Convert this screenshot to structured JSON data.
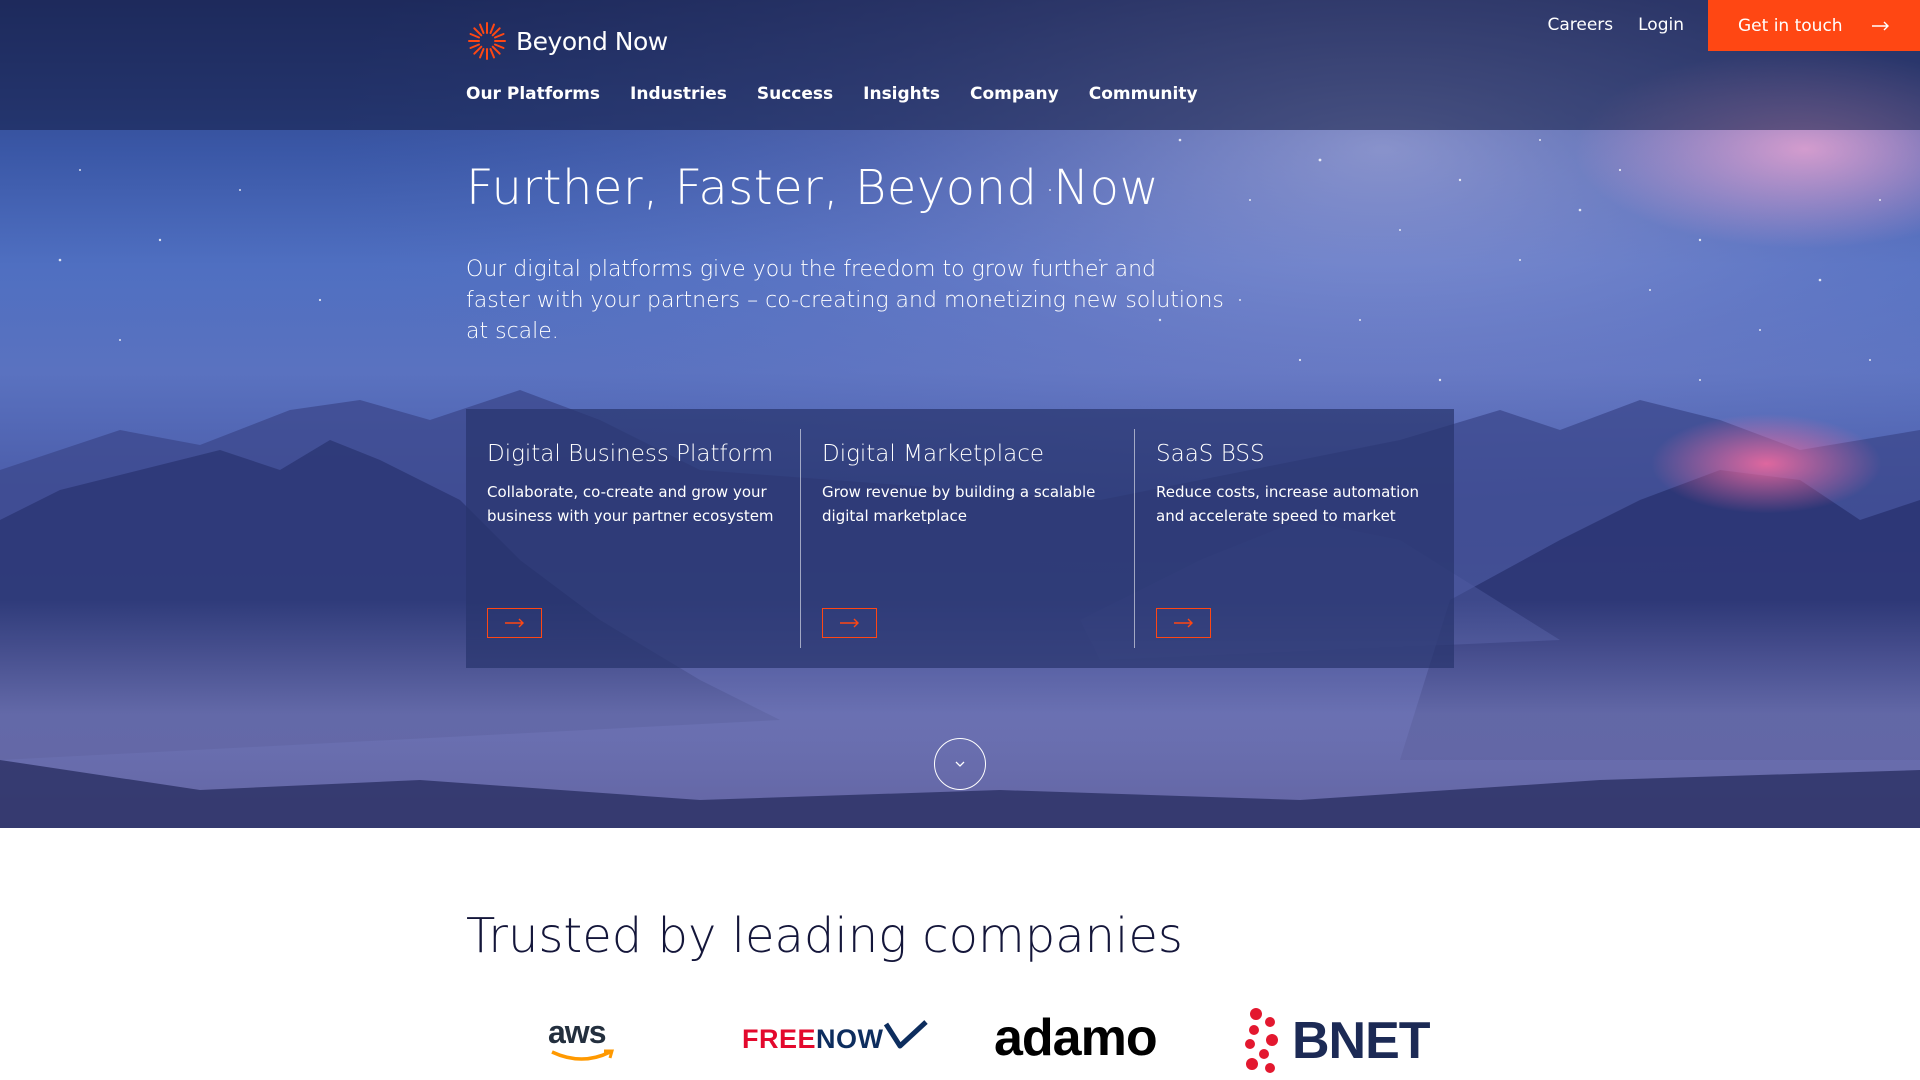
{
  "brand": {
    "name": "Beyond Now",
    "accent": "#ff4713"
  },
  "nav": {
    "main": [
      "Our Platforms",
      "Industries",
      "Success",
      "Insights",
      "Company",
      "Community"
    ],
    "careers": "Careers",
    "login": "Login",
    "cta": "Get in touch"
  },
  "hero": {
    "title": "Further, Faster, Beyond Now",
    "subtitle": "Our digital platforms give you the freedom to grow further and faster with your partners – co-creating and monetizing new solutions at scale."
  },
  "cards": [
    {
      "title": "Digital Business Platform",
      "description": "Collaborate, co-create and grow your business with your partner ecosystem"
    },
    {
      "title": "Digital Marketplace",
      "description": "Grow revenue by building a scalable digital marketplace"
    },
    {
      "title": "SaaS BSS",
      "description": "Reduce costs, increase automation and accelerate speed to market"
    }
  ],
  "trusted": {
    "title": "Trusted by leading companies",
    "logos": {
      "aws": "aws",
      "freenow_a": "FREE",
      "freenow_b": "NOW",
      "adamo": "adamo",
      "bnet": "BNET"
    }
  }
}
